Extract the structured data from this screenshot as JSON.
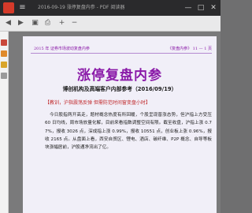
{
  "window": {
    "title": "2016-09-19 涨停复盘内参 - PDF 阅读器",
    "minimize": "—",
    "maximize": "□",
    "close": "✕"
  },
  "toolbar": {
    "icons": [
      "back-icon",
      "forward-icon",
      "save-icon",
      "print-icon",
      "zoom-in-icon",
      "zoom-out-icon"
    ]
  },
  "document": {
    "header_left": "2015 年 证券市场波动复盘内参",
    "header_right": "《复盘内参》 11 — 1 页",
    "main_title": "涨停复盘内参",
    "subtitle": "博创机构及高端客户内部参考（2016/09/19）",
    "tagline": "【教训，沪指震荡反弹 但需防范时间窗变盘小时】",
    "paragraph": "今日股指两开高走，题材概念热度有所回暖，个股呈现普涨态势，但沪指上方受压 60 日均线，周市场放量化解，目前来看指数调整空间有限。截至收盘，沪指上涨 0.77%，报收 3026 点，深成指上涨 0.99%，报收 10551 点，创业板上涨 0.96%，报收 2165 点。从盘面上看，西安自贸区、锂电、酒店、碳纤维、P2P 概念、自导等板块涨幅居前，沪股通净流出了亿。"
  }
}
